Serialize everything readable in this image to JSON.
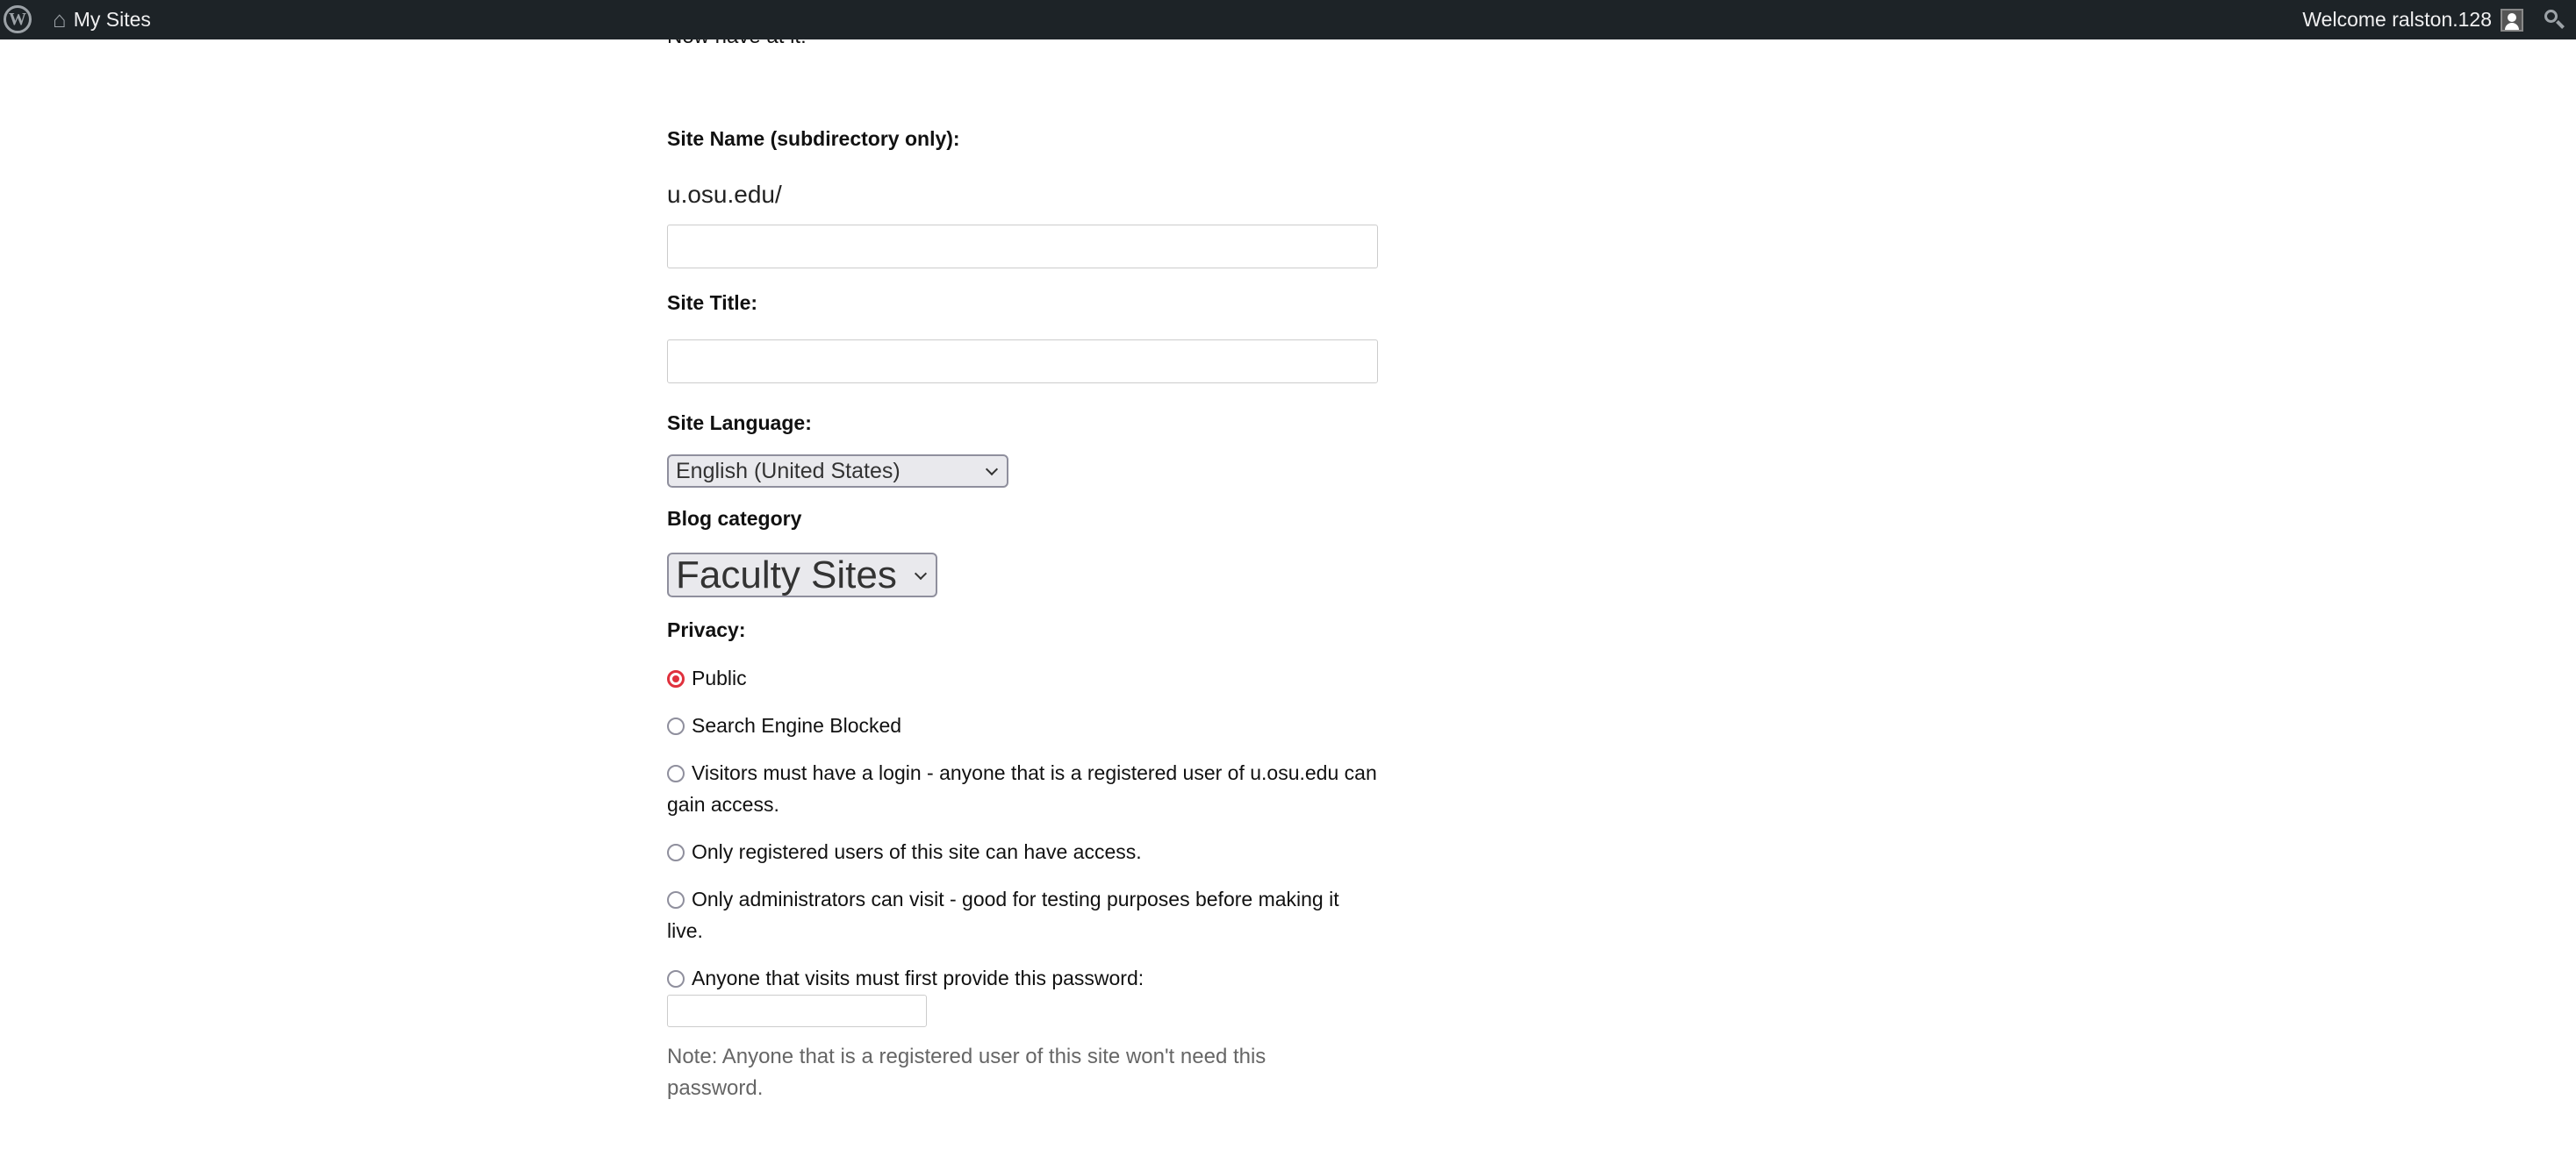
{
  "adminbar": {
    "my_sites": "My Sites",
    "welcome": "Welcome ralston.128"
  },
  "intro": "Now have at it!",
  "form": {
    "site_name_label": "Site Name (subdirectory only):",
    "domain_prefix": "u.osu.edu/",
    "site_name_value": "",
    "site_title_label": "Site Title:",
    "site_title_value": "",
    "language_label": "Site Language:",
    "language_value": "English (United States)",
    "category_label": "Blog category",
    "category_value": "Faculty Sites",
    "privacy_label": "Privacy:",
    "privacy_options": [
      {
        "label": "Public",
        "checked": true
      },
      {
        "label": "Search Engine Blocked",
        "checked": false
      },
      {
        "label": "Visitors must have a login - anyone that is a registered user of u.osu.edu can gain access.",
        "checked": false
      },
      {
        "label": "Only registered users of this site can have access.",
        "checked": false
      },
      {
        "label": "Only administrators can visit - good for testing purposes before making it live.",
        "checked": false
      },
      {
        "label": "Anyone that visits must first provide this password:",
        "checked": false
      }
    ],
    "password_value": "",
    "note": "Note: Anyone that is a registered user of this site won't need this password."
  },
  "colors": {
    "adminbar": "#1d2327",
    "radio_accent": "#e0313d"
  }
}
